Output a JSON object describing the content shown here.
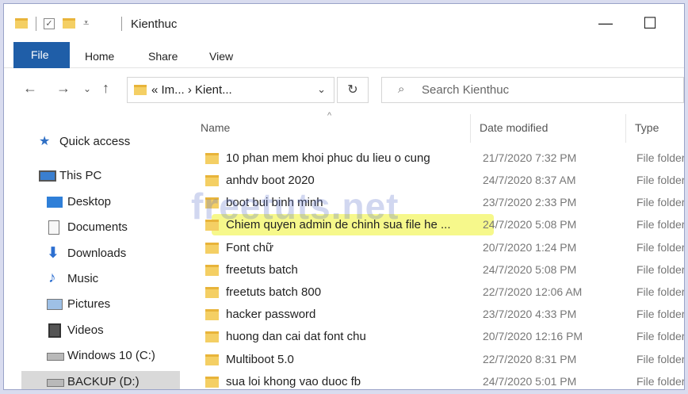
{
  "window": {
    "title": "Kienthuc",
    "min_glyph": "—",
    "max_glyph": "☐"
  },
  "ribbon": {
    "tabs": [
      "File",
      "Home",
      "Share",
      "View"
    ]
  },
  "address": {
    "path": "« Im...  ›  Kient...",
    "dropdown_glyph": "⌄",
    "refresh_glyph": "↻"
  },
  "search": {
    "placeholder": "Search Kienthuc"
  },
  "sidebar": {
    "items": [
      {
        "label": "Quick access",
        "icon": "star-icon"
      },
      {
        "label": "This PC",
        "icon": "pc-icon"
      },
      {
        "label": "Desktop",
        "icon": "desktop-icon"
      },
      {
        "label": "Documents",
        "icon": "documents-icon"
      },
      {
        "label": "Downloads",
        "icon": "download-icon"
      },
      {
        "label": "Music",
        "icon": "music-icon"
      },
      {
        "label": "Pictures",
        "icon": "pictures-icon"
      },
      {
        "label": "Videos",
        "icon": "videos-icon"
      },
      {
        "label": "Windows 10 (C:)",
        "icon": "drive-icon"
      },
      {
        "label": "BACKUP (D:)",
        "icon": "drive-icon"
      }
    ]
  },
  "columns": {
    "name": "Name",
    "date": "Date modified",
    "type": "Type"
  },
  "files": [
    {
      "name": "10 phan mem khoi phuc du lieu o cung",
      "date": "21/7/2020 7:32 PM",
      "type": "File folder"
    },
    {
      "name": "anhdv boot 2020",
      "date": "24/7/2020 8:37 AM",
      "type": "File folder"
    },
    {
      "name": "boot bui binh minh",
      "date": "23/7/2020 2:33 PM",
      "type": "File folder"
    },
    {
      "name": "Chiem quyen admin de chinh sua file he ...",
      "date": "24/7/2020 5:08 PM",
      "type": "File folder"
    },
    {
      "name": "Font chữ",
      "date": "20/7/2020 1:24 PM",
      "type": "File folder"
    },
    {
      "name": "freetuts batch",
      "date": "24/7/2020 5:08 PM",
      "type": "File folder"
    },
    {
      "name": "freetuts batch 800",
      "date": "22/7/2020 12:06 AM",
      "type": "File folder"
    },
    {
      "name": "hacker password",
      "date": "23/7/2020 4:33 PM",
      "type": "File folder"
    },
    {
      "name": "huong dan cai dat font chu",
      "date": "20/7/2020 12:16 PM",
      "type": "File folder"
    },
    {
      "name": "Multiboot 5.0",
      "date": "22/7/2020 8:31 PM",
      "type": "File folder"
    },
    {
      "name": "sua loi khong vao duoc fb",
      "date": "24/7/2020 5:01 PM",
      "type": "File folder"
    }
  ],
  "highlighted_row": "Chiem quyen admin de chinh sua file he ...",
  "watermark": "freetuts.net",
  "colors": {
    "file_tab": "#1f5ea8",
    "folder": "#f4cf64",
    "highlight": "#f2f55a"
  }
}
